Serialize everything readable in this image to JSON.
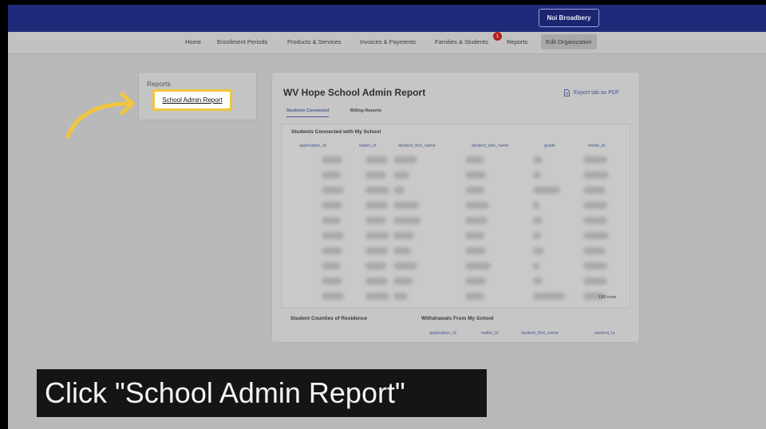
{
  "header": {
    "user_name": "Noi Broadbery"
  },
  "nav": {
    "items": [
      "Home",
      "Enrollment Periods",
      "Products & Services",
      "Invoices & Payments",
      "Families & Students",
      "Reports",
      "Edit Organization"
    ],
    "reports_badge": "1"
  },
  "sidebar": {
    "title": "Reports",
    "link": "School Admin Report"
  },
  "report": {
    "title": "WV Hope School Admin Report",
    "export_label": "Export tab as PDF",
    "tabs": [
      "Students Connected",
      "Billing Reports"
    ],
    "section_title": "Students Connected with My School",
    "columns": [
      "application_id",
      "wallet_id",
      "student_first_name",
      "student_last_name",
      "grade",
      "wwds_id"
    ],
    "row_count": "199 rows",
    "counties_title": "Student Counties of Residence",
    "withdrawals_title": "Withdrawals From My School",
    "withdrawal_columns": [
      "application_id",
      "wallet_id",
      "student_first_name",
      "student_la"
    ]
  },
  "caption": {
    "text": "Click \"School Admin Report\""
  },
  "colors": {
    "topbar": "#1f2b7a",
    "highlight": "#f2c53d",
    "accent": "#4c5a93",
    "badge": "#b21f1f"
  }
}
